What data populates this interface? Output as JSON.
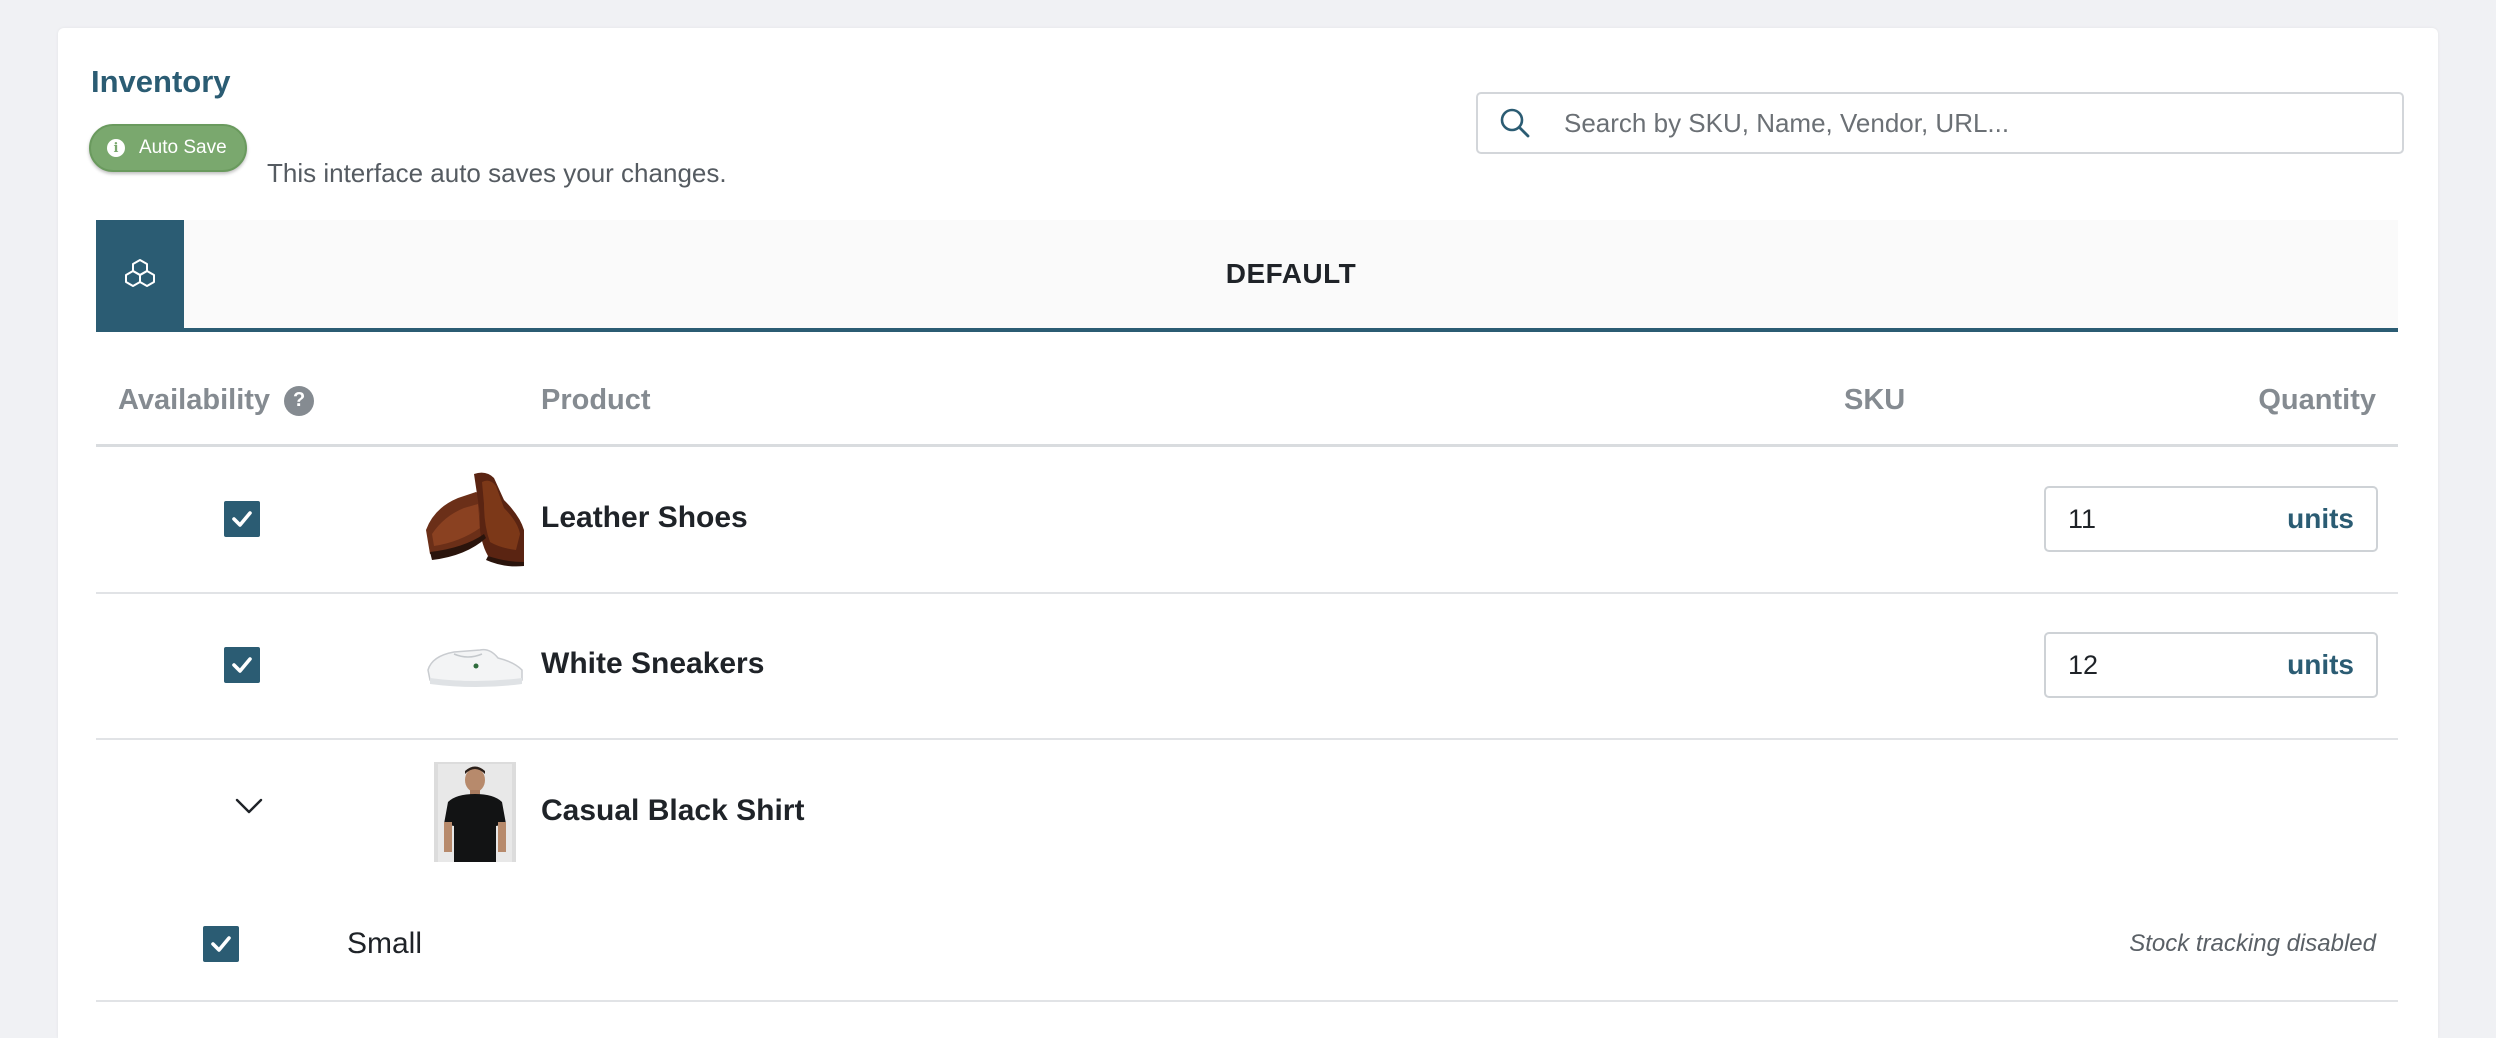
{
  "header": {
    "title": "Inventory",
    "autosave_badge": "Auto Save",
    "autosave_description": "This interface auto saves your changes."
  },
  "search": {
    "placeholder": "Search by SKU, Name, Vendor, URL...",
    "value": ""
  },
  "tabs": [
    {
      "label": "DEFAULT",
      "active": true
    }
  ],
  "table": {
    "columns": {
      "availability": "Availability",
      "product": "Product",
      "sku": "SKU",
      "quantity": "Quantity"
    },
    "rows": [
      {
        "name": "Leather Shoes",
        "available": true,
        "sku": "",
        "quantity": "11",
        "unit": "units",
        "image": "brown-leather-shoes"
      },
      {
        "name": "White Sneakers",
        "available": true,
        "sku": "",
        "quantity": "12",
        "unit": "units",
        "image": "white-sneakers"
      },
      {
        "name": "Casual Black Shirt",
        "expandable": true,
        "expanded": true,
        "image": "black-shirt-model",
        "variants": [
          {
            "name": "Small",
            "available": true,
            "stock_note": "Stock tracking disabled"
          }
        ]
      }
    ]
  },
  "colors": {
    "accent": "#2b5c73",
    "autosave_green": "#7aa86e",
    "muted_header": "#858b91",
    "background": "#f0f1f4"
  }
}
